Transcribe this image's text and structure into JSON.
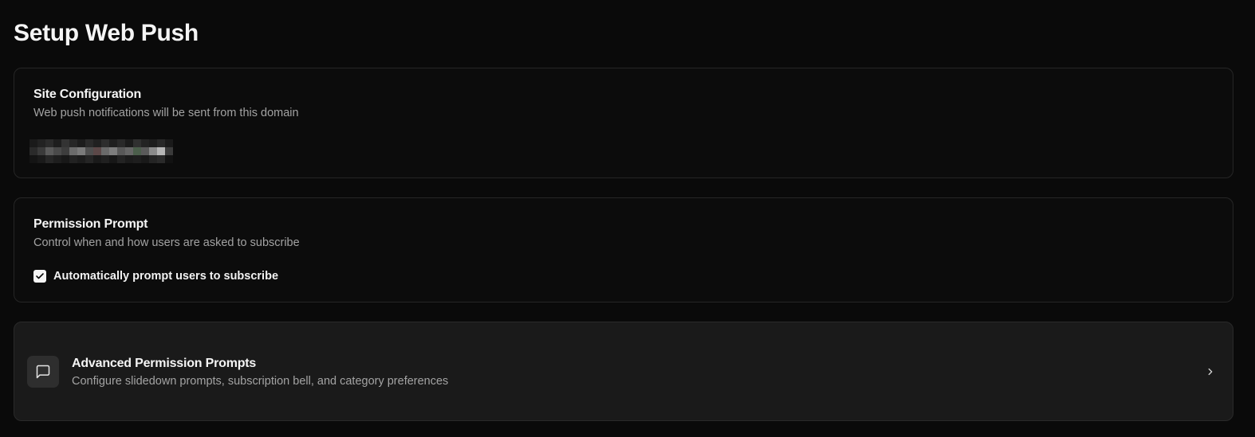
{
  "page": {
    "title": "Setup Web Push"
  },
  "site_configuration": {
    "title": "Site Configuration",
    "description": "Web push notifications will be sent from this domain",
    "domain_value_redacted": true
  },
  "permission_prompt": {
    "title": "Permission Prompt",
    "description": "Control when and how users are asked to subscribe",
    "auto_prompt": {
      "label": "Automatically prompt users to subscribe",
      "checked": true
    }
  },
  "advanced_prompts": {
    "title": "Advanced Permission Prompts",
    "description": "Configure slidedown prompts, subscription bell, and category preferences",
    "icon": "message-square-icon",
    "chevron": "chevron-right-icon"
  },
  "colors": {
    "background": "#0a0a0a",
    "card_border": "#262626",
    "advanced_card_bg": "#1a1a1a",
    "muted_text": "#a3a3a3",
    "checkbox_bg": "#f5f5f5"
  }
}
